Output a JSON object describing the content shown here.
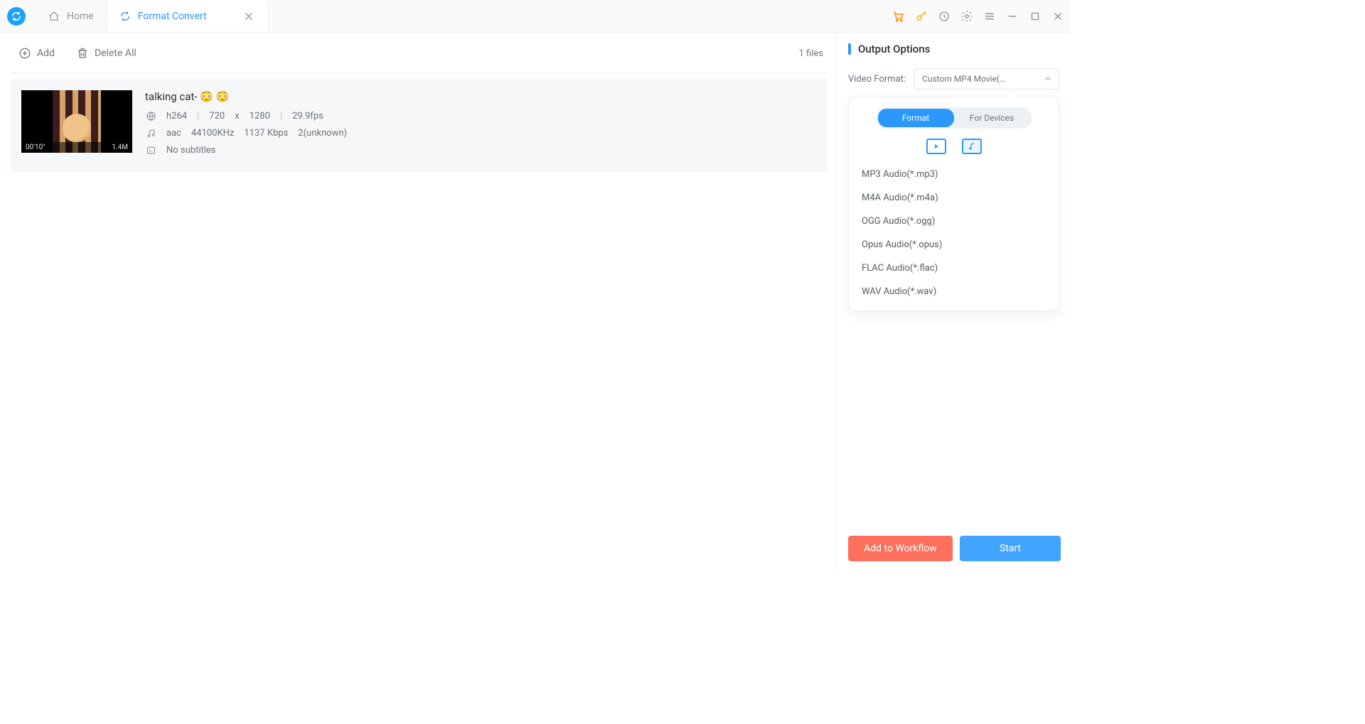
{
  "tabs": {
    "home_label": "Home",
    "active_label": "Format Convert"
  },
  "toolbar": {
    "add_label": "Add",
    "delete_all_label": "Delete All",
    "file_count_label": "1 files"
  },
  "file": {
    "title": "talking cat- 😳 😳",
    "duration_overlay": "00'10\"",
    "size_overlay": "1.4M",
    "video": {
      "codec": "h264",
      "width": "720",
      "x": "x",
      "height": "1280",
      "fps": "29.9fps"
    },
    "audio": {
      "codec": "aac",
      "sample_rate": "44100KHz",
      "bitrate": "1137 Kbps",
      "channels": "2(unknown)"
    },
    "subtitles": "No subtitles"
  },
  "side": {
    "panel_title": "Output Options",
    "video_format_label": "Video Format:",
    "video_format_value": "Custom MP4 Movie(…",
    "seg_format": "Format",
    "seg_devices": "For Devices",
    "formats": [
      "MP3 Audio(*.mp3)",
      "M4A Audio(*.m4a)",
      "OGG Audio(*.ogg)",
      "Opus Audio(*.opus)",
      "FLAC Audio(*.flac)",
      "WAV Audio(*.wav)"
    ]
  },
  "footer": {
    "workflow": "Add to Workflow",
    "start": "Start"
  }
}
